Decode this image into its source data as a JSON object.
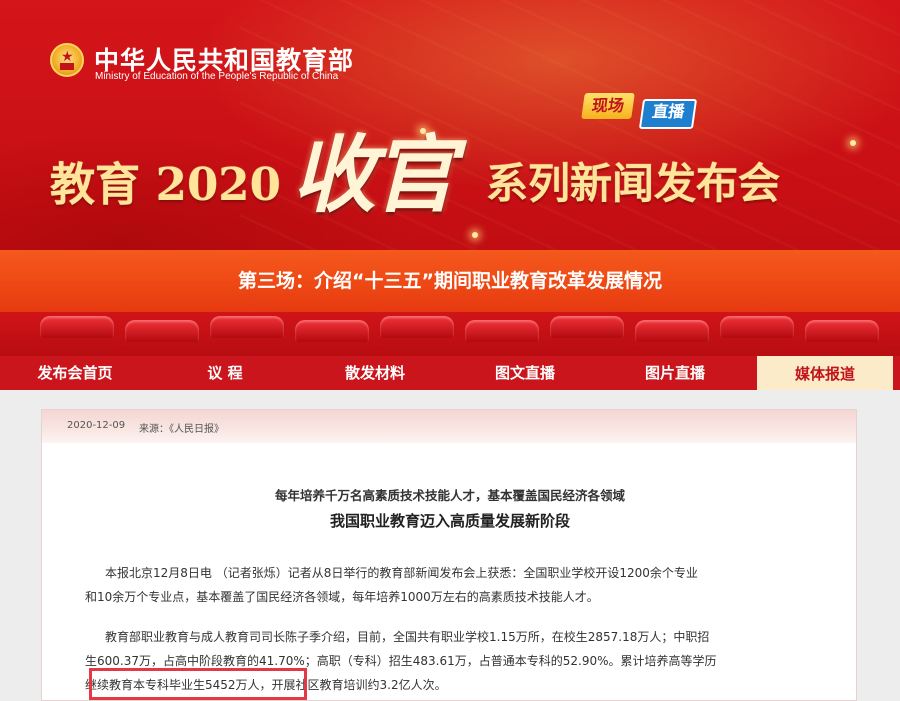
{
  "header": {
    "ministry_cn": "中华人民共和国教育部",
    "ministry_en": "Ministry of Education of the People's Republic of China",
    "live_badge": [
      "现场",
      "直播"
    ],
    "title_left": "教育 2020",
    "title_mid": "收官",
    "title_right": "系列新闻发布会",
    "session": "第三场：介绍“十三五”期间职业教育改革发展情况"
  },
  "nav": {
    "items": [
      {
        "label": "发布会首页"
      },
      {
        "label": "议 程"
      },
      {
        "label": "散发材料"
      },
      {
        "label": "图文直播"
      },
      {
        "label": "图片直播"
      },
      {
        "label": "媒体报道"
      }
    ],
    "active_index": 5
  },
  "article": {
    "date": "2020-12-09",
    "source_label": "来源：",
    "source_value": "《人民日报》",
    "subtitle": "每年培养千万名高素质技术技能人才，基本覆盖国民经济各领域",
    "headline": "我国职业教育迈入高质量发展新阶段",
    "paragraphs": [
      [
        "本报北京12月8日电 （记者张烁）记者从8日举行的教育部新闻发布会上获悉：全国职业学校开设1200余个专业",
        "和10余万个专业点，基本覆盖了国民经济各领域，每年培养1000万左右的高素质技术技能人才。"
      ],
      [
        "教育部职业教育与成人教育司司长陈子季介绍，目前，全国共有职业学校1.15万所，在校生2857.18万人；中职招",
        "生600.37万，占高中阶段教育的41.70%；高职（专科）招生483.61万，占普通本专科的52.90%。累计培养高等学历",
        "继续教育本专科毕业生5452万人，开展社区教育培训约3.2亿人次。"
      ]
    ]
  },
  "colors": {
    "banner_red": "#c70f14",
    "session_orange": "#ef4a15",
    "nav_red": "#c9151b",
    "nav_active_bg": "#fcebc9",
    "highlight_border": "#e53847"
  }
}
